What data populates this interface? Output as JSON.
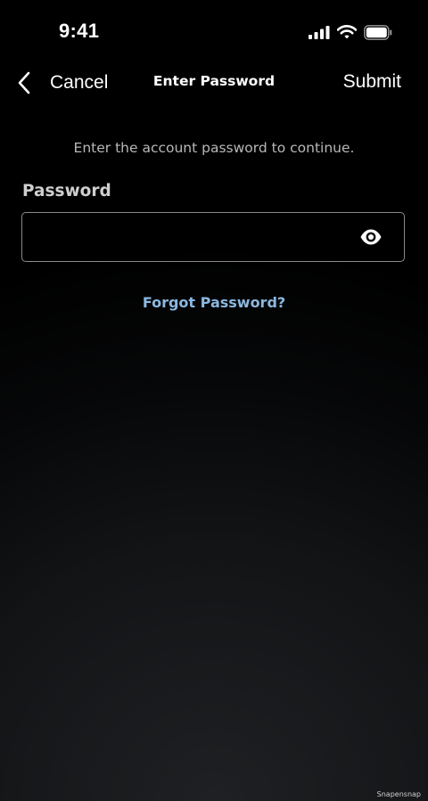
{
  "status_bar": {
    "time": "9:41",
    "icons": [
      "signal-icon",
      "wifi-icon",
      "battery-icon"
    ]
  },
  "nav": {
    "back_icon": "chevron-left-icon",
    "cancel_label": "Cancel",
    "title": "Enter Password",
    "submit_label": "Submit"
  },
  "form": {
    "instruction": "Enter the account password to continue.",
    "password_label": "Password",
    "password_value": "",
    "password_placeholder": "",
    "visibility_icon": "eye-icon",
    "forgot_password_label": "Forgot Password?"
  },
  "watermark": "Snapensnap",
  "colors": {
    "background": "#000000",
    "text_primary": "#ffffff",
    "text_secondary": "#b8b8b8",
    "label": "#cfcfcf",
    "field_border": "#8a8a8a",
    "link": "#8cb8e0"
  }
}
